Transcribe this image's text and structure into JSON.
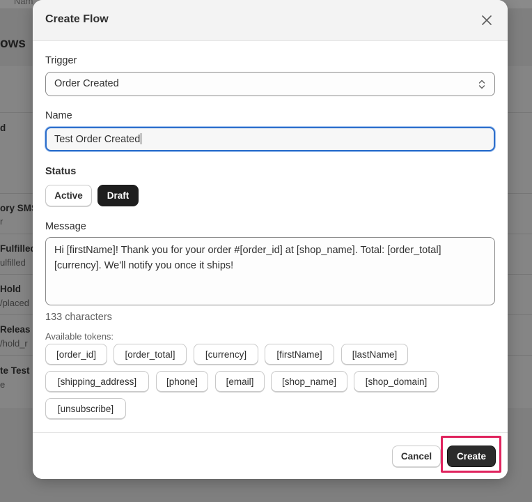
{
  "background": {
    "top_text": "Nam",
    "heading": "ows",
    "rows": [
      {
        "title": "d",
        "sub": ""
      },
      {
        "title": "ory SMS",
        "sub": "r"
      },
      {
        "title": "Fulfilled",
        "sub": "ulfilled"
      },
      {
        "title": "Hold",
        "sub": "/placed"
      },
      {
        "title": "Releas",
        "sub": "/hold_r"
      },
      {
        "title": "te Test",
        "sub": "e"
      }
    ]
  },
  "modal": {
    "title": "Create Flow",
    "trigger": {
      "label": "Trigger",
      "selected": "Order Created"
    },
    "name": {
      "label": "Name",
      "value": "Test Order Created"
    },
    "status": {
      "label": "Status",
      "options": [
        "Active",
        "Draft"
      ],
      "selected": "Draft"
    },
    "message": {
      "label": "Message",
      "value": "Hi [firstName]! Thank you for your order #[order_id] at [shop_name]. Total: [order_total] [currency]. We'll notify you once it ships!",
      "char_count": "133 characters"
    },
    "tokens": {
      "label": "Available tokens:",
      "items": [
        "[order_id]",
        "[order_total]",
        "[currency]",
        "[firstName]",
        "[lastName]",
        "[shipping_address]",
        "[phone]",
        "[email]",
        "[shop_name]",
        "[shop_domain]",
        "[unsubscribe]"
      ]
    },
    "footer": {
      "cancel_label": "Cancel",
      "create_label": "Create"
    }
  },
  "colors": {
    "focus_ring": "#2c6ecb",
    "primary_button": "#2b2b2b",
    "highlight": "#e0245e"
  }
}
